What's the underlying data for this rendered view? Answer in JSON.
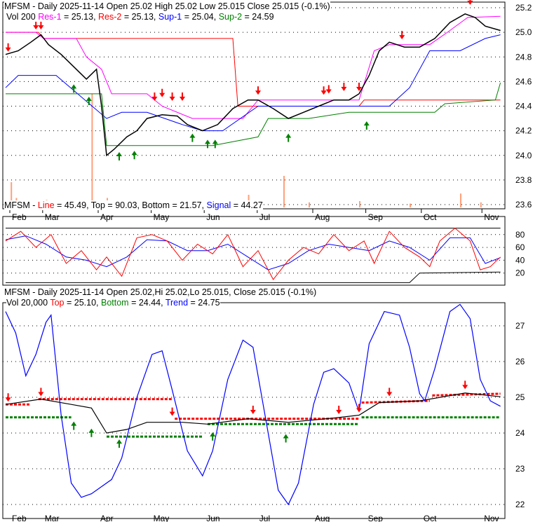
{
  "colors": {
    "res1": "#ff00ff",
    "res2": "#ff0000",
    "sup1": "#0000ff",
    "sup2": "#008000",
    "volume": "#ffa07a",
    "up": "#008000",
    "down": "#ff0000"
  },
  "panel1": {
    "title": "MFSM - Daily 2025-11-14 Open 25.02  High 25.02  Low 25.015  Close 25.015 (-0.1%)",
    "vol": "Vol 200",
    "res1_label": "Res-1",
    "res1_val": " = 25.13, ",
    "res2_label": "Res-2",
    "res2_val": " = 25.13, ",
    "sup1_label": "Sup-1",
    "sup1_val": " = 25.04, ",
    "sup2_label": "Sup-2",
    "sup2_val": " = 24.59"
  },
  "panel2": {
    "sym": "MFSM - ",
    "line_label": "Line",
    "line_val": " = 45.49, Top = 90.03, Bottom = 21.57, ",
    "signal_label": "Signal",
    "signal_val": " = 44.27"
  },
  "panel3": {
    "title": "MFSM - Daily 2025-11-14 Open 25.02,Hi 25.02,Lo 25.015, Close 25.015 (-0.1%)",
    "vol": "Vol 20,000 ",
    "top_label": "Top",
    "top_val": " = 25.10, ",
    "bottom_label": "Bottom",
    "bottom_val": " = 24.44, ",
    "trend_label": "Trend",
    "trend_val": " = 24.75"
  },
  "chart_data": [
    {
      "type": "line",
      "title": "MFSM - Daily 2025-11-14",
      "ylim": [
        23.6,
        25.2
      ],
      "yticks": [
        "25.2",
        "25.0",
        "24.8",
        "24.6",
        "24.4",
        "24.2",
        "24.0",
        "23.8",
        "23.6"
      ],
      "months": [
        {
          "label": "Feb",
          "i": 0
        },
        {
          "label": "Mar",
          "i": 13
        },
        {
          "label": "Apr",
          "i": 35
        },
        {
          "label": "May",
          "i": 56
        },
        {
          "label": "Jun",
          "i": 77
        },
        {
          "label": "Jul",
          "i": 98
        },
        {
          "label": "Aug",
          "i": 120
        },
        {
          "label": "Sep",
          "i": 141
        },
        {
          "label": "Oct",
          "i": 163
        },
        {
          "label": "Nov",
          "i": 187
        }
      ],
      "close": [
        [
          0,
          24.82
        ],
        [
          5,
          24.85
        ],
        [
          10,
          24.92
        ],
        [
          14,
          24.98
        ],
        [
          17,
          24.9
        ],
        [
          22,
          24.82
        ],
        [
          27,
          24.72
        ],
        [
          32,
          24.62
        ],
        [
          36,
          24.7
        ],
        [
          38,
          24.4
        ],
        [
          40,
          24.0
        ],
        [
          43,
          24.05
        ],
        [
          48,
          24.15
        ],
        [
          52,
          24.2
        ],
        [
          56,
          24.3
        ],
        [
          62,
          24.33
        ],
        [
          68,
          24.32
        ],
        [
          72,
          24.25
        ],
        [
          78,
          24.2
        ],
        [
          84,
          24.25
        ],
        [
          90,
          24.38
        ],
        [
          96,
          24.45
        ],
        [
          100,
          24.45
        ],
        [
          106,
          24.38
        ],
        [
          112,
          24.3
        ],
        [
          118,
          24.35
        ],
        [
          124,
          24.4
        ],
        [
          130,
          24.45
        ],
        [
          136,
          24.45
        ],
        [
          140,
          24.5
        ],
        [
          144,
          24.65
        ],
        [
          148,
          24.85
        ],
        [
          152,
          24.92
        ],
        [
          158,
          24.88
        ],
        [
          164,
          24.88
        ],
        [
          170,
          24.95
        ],
        [
          176,
          25.08
        ],
        [
          182,
          25.15
        ],
        [
          186,
          25.12
        ],
        [
          190,
          25.05
        ],
        [
          196,
          25.015
        ]
      ],
      "volume": [
        [
          0,
          10
        ],
        [
          2,
          40
        ],
        [
          4,
          15
        ],
        [
          6,
          8
        ],
        [
          10,
          6
        ],
        [
          16,
          12
        ],
        [
          25,
          10
        ],
        [
          34,
          180
        ],
        [
          40,
          15
        ],
        [
          48,
          8
        ],
        [
          60,
          10
        ],
        [
          70,
          8
        ],
        [
          80,
          5
        ],
        [
          96,
          20
        ],
        [
          110,
          50
        ],
        [
          120,
          8
        ],
        [
          140,
          10
        ],
        [
          160,
          6
        ],
        [
          180,
          22
        ],
        [
          188,
          8
        ]
      ],
      "res1": [
        [
          0,
          25.0
        ],
        [
          12,
          25.0
        ],
        [
          15,
          24.95
        ],
        [
          28,
          24.95
        ],
        [
          32,
          24.8
        ],
        [
          38,
          24.7
        ],
        [
          42,
          24.5
        ],
        [
          56,
          24.5
        ],
        [
          62,
          24.4
        ],
        [
          74,
          24.3
        ],
        [
          94,
          24.3
        ],
        [
          100,
          24.45
        ],
        [
          140,
          24.45
        ],
        [
          146,
          24.85
        ],
        [
          152,
          24.9
        ],
        [
          168,
          24.9
        ],
        [
          175,
          25.0
        ],
        [
          183,
          25.12
        ],
        [
          196,
          25.13
        ]
      ],
      "res2": [
        [
          0,
          25.0
        ],
        [
          13,
          25.0
        ],
        [
          15,
          24.95
        ],
        [
          90,
          24.95
        ],
        [
          92,
          24.4
        ],
        [
          140,
          24.4
        ],
        [
          142,
          24.45
        ],
        [
          196,
          24.45
        ]
      ],
      "sup1": [
        [
          0,
          24.55
        ],
        [
          5,
          24.65
        ],
        [
          20,
          24.65
        ],
        [
          40,
          24.3
        ],
        [
          46,
          24.35
        ],
        [
          56,
          24.35
        ],
        [
          70,
          24.25
        ],
        [
          78,
          24.2
        ],
        [
          86,
          24.2
        ],
        [
          100,
          24.4
        ],
        [
          140,
          24.4
        ],
        [
          152,
          24.4
        ],
        [
          160,
          24.55
        ],
        [
          168,
          24.85
        ],
        [
          180,
          24.85
        ],
        [
          190,
          24.95
        ],
        [
          196,
          24.98
        ]
      ],
      "sup2": [
        [
          0,
          24.5
        ],
        [
          38,
          24.5
        ],
        [
          40,
          24.08
        ],
        [
          82,
          24.08
        ],
        [
          100,
          24.15
        ],
        [
          104,
          24.3
        ],
        [
          120,
          24.3
        ],
        [
          136,
          24.35
        ],
        [
          140,
          24.35
        ],
        [
          170,
          24.35
        ],
        [
          174,
          24.42
        ],
        [
          194,
          24.45
        ],
        [
          196,
          24.59
        ]
      ],
      "arrows_down": [
        [
          1,
          24.82
        ],
        [
          12,
          25.0
        ],
        [
          14,
          25.0
        ],
        [
          59,
          24.42
        ],
        [
          62,
          24.45
        ],
        [
          66,
          24.42
        ],
        [
          70,
          24.42
        ],
        [
          100,
          24.47
        ],
        [
          126,
          24.47
        ],
        [
          128,
          24.48
        ],
        [
          134,
          24.5
        ],
        [
          140,
          24.5
        ],
        [
          157,
          24.92
        ],
        [
          184,
          25.2
        ]
      ],
      "arrows_up": [
        [
          27,
          24.6
        ],
        [
          33,
          24.5
        ],
        [
          45,
          24.05
        ],
        [
          51,
          24.06
        ],
        [
          74,
          24.2
        ],
        [
          80,
          24.15
        ],
        [
          83,
          24.15
        ],
        [
          112,
          24.2
        ],
        [
          143,
          24.3
        ]
      ]
    },
    {
      "type": "line",
      "title": "MFSM Money Flow",
      "ylim": [
        0,
        100
      ],
      "yticks": [
        "80",
        "60",
        "40",
        "20"
      ],
      "line": [
        [
          0,
          70
        ],
        [
          6,
          85
        ],
        [
          12,
          60
        ],
        [
          18,
          80
        ],
        [
          24,
          35
        ],
        [
          30,
          55
        ],
        [
          36,
          25
        ],
        [
          40,
          45
        ],
        [
          46,
          15
        ],
        [
          52,
          75
        ],
        [
          58,
          80
        ],
        [
          64,
          70
        ],
        [
          70,
          40
        ],
        [
          76,
          65
        ],
        [
          82,
          50
        ],
        [
          88,
          80
        ],
        [
          94,
          30
        ],
        [
          100,
          55
        ],
        [
          106,
          10
        ],
        [
          112,
          40
        ],
        [
          118,
          60
        ],
        [
          124,
          50
        ],
        [
          130,
          80
        ],
        [
          136,
          55
        ],
        [
          142,
          70
        ],
        [
          146,
          35
        ],
        [
          152,
          85
        ],
        [
          158,
          60
        ],
        [
          164,
          45
        ],
        [
          168,
          30
        ],
        [
          172,
          70
        ],
        [
          178,
          90
        ],
        [
          184,
          70
        ],
        [
          188,
          25
        ],
        [
          192,
          30
        ],
        [
          196,
          45
        ]
      ],
      "signal": [
        [
          0,
          72
        ],
        [
          8,
          78
        ],
        [
          16,
          65
        ],
        [
          24,
          45
        ],
        [
          32,
          40
        ],
        [
          40,
          30
        ],
        [
          48,
          45
        ],
        [
          56,
          72
        ],
        [
          64,
          70
        ],
        [
          72,
          55
        ],
        [
          80,
          55
        ],
        [
          88,
          65
        ],
        [
          96,
          45
        ],
        [
          104,
          25
        ],
        [
          112,
          35
        ],
        [
          120,
          55
        ],
        [
          128,
          65
        ],
        [
          136,
          60
        ],
        [
          144,
          55
        ],
        [
          152,
          70
        ],
        [
          160,
          60
        ],
        [
          168,
          40
        ],
        [
          176,
          75
        ],
        [
          184,
          75
        ],
        [
          190,
          35
        ],
        [
          196,
          44
        ]
      ],
      "top": [
        [
          0,
          90
        ],
        [
          196,
          90
        ]
      ],
      "bottom": [
        [
          0,
          5
        ],
        [
          160,
          5
        ],
        [
          164,
          20
        ],
        [
          196,
          21.5
        ]
      ]
    },
    {
      "type": "line",
      "title": "MFSM Trend",
      "ylim": [
        21.8,
        27.8
      ],
      "yticks": [
        "27",
        "26",
        "25",
        "24",
        "23",
        "22"
      ],
      "trend": [
        [
          0,
          27.4
        ],
        [
          4,
          26.8
        ],
        [
          8,
          25.6
        ],
        [
          12,
          26.2
        ],
        [
          16,
          27.1
        ],
        [
          18,
          27.3
        ],
        [
          22,
          24.5
        ],
        [
          26,
          22.6
        ],
        [
          30,
          22.2
        ],
        [
          34,
          22.3
        ],
        [
          38,
          22.5
        ],
        [
          42,
          22.7
        ],
        [
          46,
          23.3
        ],
        [
          52,
          25.0
        ],
        [
          58,
          26.2
        ],
        [
          62,
          26.3
        ],
        [
          66,
          25.2
        ],
        [
          72,
          23.5
        ],
        [
          78,
          22.8
        ],
        [
          82,
          23.5
        ],
        [
          88,
          25.5
        ],
        [
          94,
          26.6
        ],
        [
          98,
          26.4
        ],
        [
          104,
          24
        ],
        [
          108,
          22.4
        ],
        [
          112,
          22.0
        ],
        [
          116,
          22.6
        ],
        [
          122,
          24.8
        ],
        [
          126,
          25.7
        ],
        [
          130,
          25.8
        ],
        [
          136,
          25.4
        ],
        [
          140,
          24.6
        ],
        [
          144,
          26.5
        ],
        [
          150,
          27.4
        ],
        [
          156,
          27.3
        ],
        [
          160,
          26.4
        ],
        [
          164,
          25.1
        ],
        [
          166,
          24.9
        ],
        [
          170,
          25.8
        ],
        [
          176,
          27.4
        ],
        [
          180,
          27.6
        ],
        [
          184,
          27.2
        ],
        [
          188,
          25.5
        ],
        [
          192,
          24.9
        ],
        [
          196,
          24.75
        ]
      ],
      "top_segments": [
        [
          [
            0,
            24.8
          ],
          [
            10,
            24.8
          ]
        ],
        [
          [
            13,
            24.95
          ],
          [
            66,
            24.95
          ]
        ],
        [
          [
            67,
            24.4
          ],
          [
            140,
            24.4
          ]
        ],
        [
          [
            141,
            24.85
          ],
          [
            168,
            24.9
          ]
        ],
        [
          [
            169,
            25.05
          ],
          [
            196,
            25.1
          ]
        ]
      ],
      "bottom_segments": [
        [
          [
            0,
            24.44
          ],
          [
            26,
            24.44
          ]
        ],
        [
          [
            40,
            23.9
          ],
          [
            78,
            23.9
          ]
        ],
        [
          [
            80,
            24.25
          ],
          [
            140,
            24.25
          ]
        ],
        [
          [
            141,
            24.44
          ],
          [
            196,
            24.44
          ]
        ]
      ],
      "close": [
        [
          0,
          24.8
        ],
        [
          14,
          24.95
        ],
        [
          26,
          24.8
        ],
        [
          34,
          24.7
        ],
        [
          40,
          24.0
        ],
        [
          48,
          24.1
        ],
        [
          56,
          24.3
        ],
        [
          70,
          24.3
        ],
        [
          80,
          24.25
        ],
        [
          96,
          24.4
        ],
        [
          112,
          24.3
        ],
        [
          130,
          24.42
        ],
        [
          140,
          24.5
        ],
        [
          148,
          24.85
        ],
        [
          164,
          24.9
        ],
        [
          182,
          25.12
        ],
        [
          196,
          25.015
        ]
      ],
      "arrows_down": [
        [
          1,
          24.8
        ],
        [
          14,
          24.95
        ],
        [
          66,
          24.4
        ],
        [
          98,
          24.45
        ],
        [
          132,
          24.45
        ],
        [
          140,
          24.5
        ],
        [
          152,
          24.95
        ],
        [
          182,
          25.15
        ]
      ],
      "arrows_up": [
        [
          27,
          24.4
        ],
        [
          34,
          24.2
        ],
        [
          45,
          23.9
        ],
        [
          82,
          24.1
        ],
        [
          111,
          24.05
        ]
      ]
    }
  ]
}
